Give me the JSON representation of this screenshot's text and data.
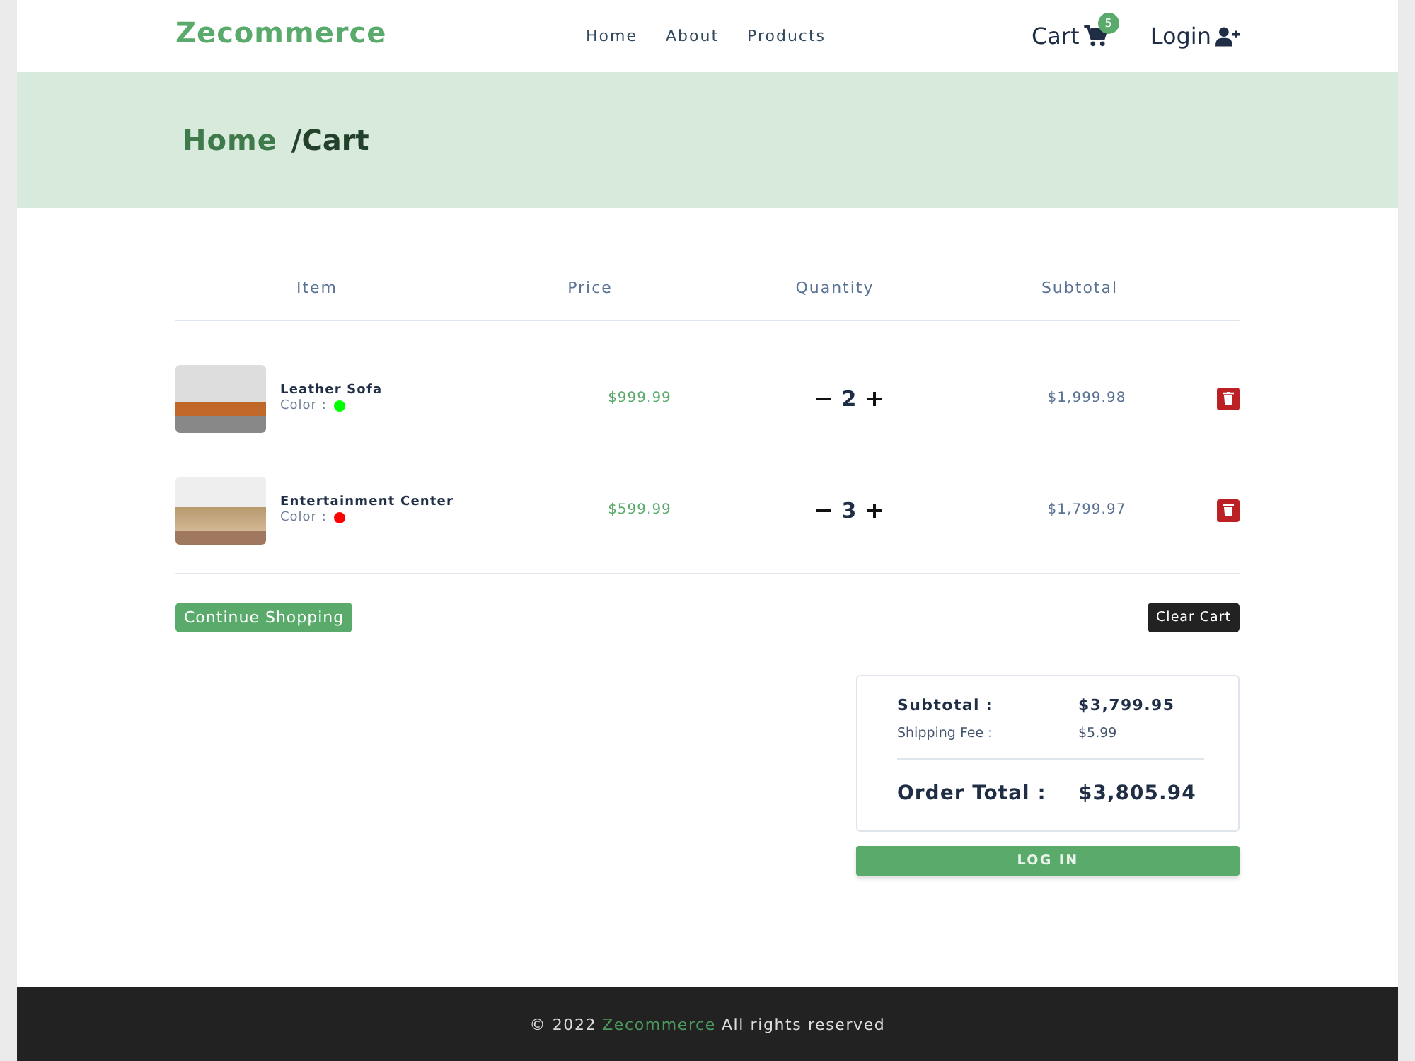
{
  "navbar": {
    "logo": "Zecommerce",
    "links": [
      "Home",
      "About",
      "Products"
    ],
    "cart": {
      "label": "Cart",
      "count": "5"
    },
    "login": "Login"
  },
  "breadcrumb": {
    "home": "Home",
    "current": "/Cart"
  },
  "table": {
    "columns": [
      "Item",
      "Price",
      "Quantity",
      "Subtotal"
    ],
    "rows": [
      {
        "name": "Leather Sofa",
        "color_label": "Color :",
        "color": "#00ff00",
        "price": "$999.99",
        "quantity": "2",
        "subtotal": "$1,999.98"
      },
      {
        "name": "Entertainment Center",
        "color_label": "Color :",
        "color": "#ff0000",
        "price": "$599.99",
        "quantity": "3",
        "subtotal": "$1,799.97"
      }
    ]
  },
  "actions": {
    "continue": "Continue Shopping",
    "clear": "Clear Cart"
  },
  "totals": {
    "subtotal_label": "Subtotal :",
    "subtotal": "$3,799.95",
    "shipping_label": "Shipping Fee :",
    "shipping": "$5.99",
    "order_label": "Order Total :",
    "order_total": "$3,805.94"
  },
  "login_button": "LOG IN",
  "footer": {
    "prefix": "© 2022",
    "brand": "Zecommerce",
    "suffix": "All rights reserved"
  }
}
